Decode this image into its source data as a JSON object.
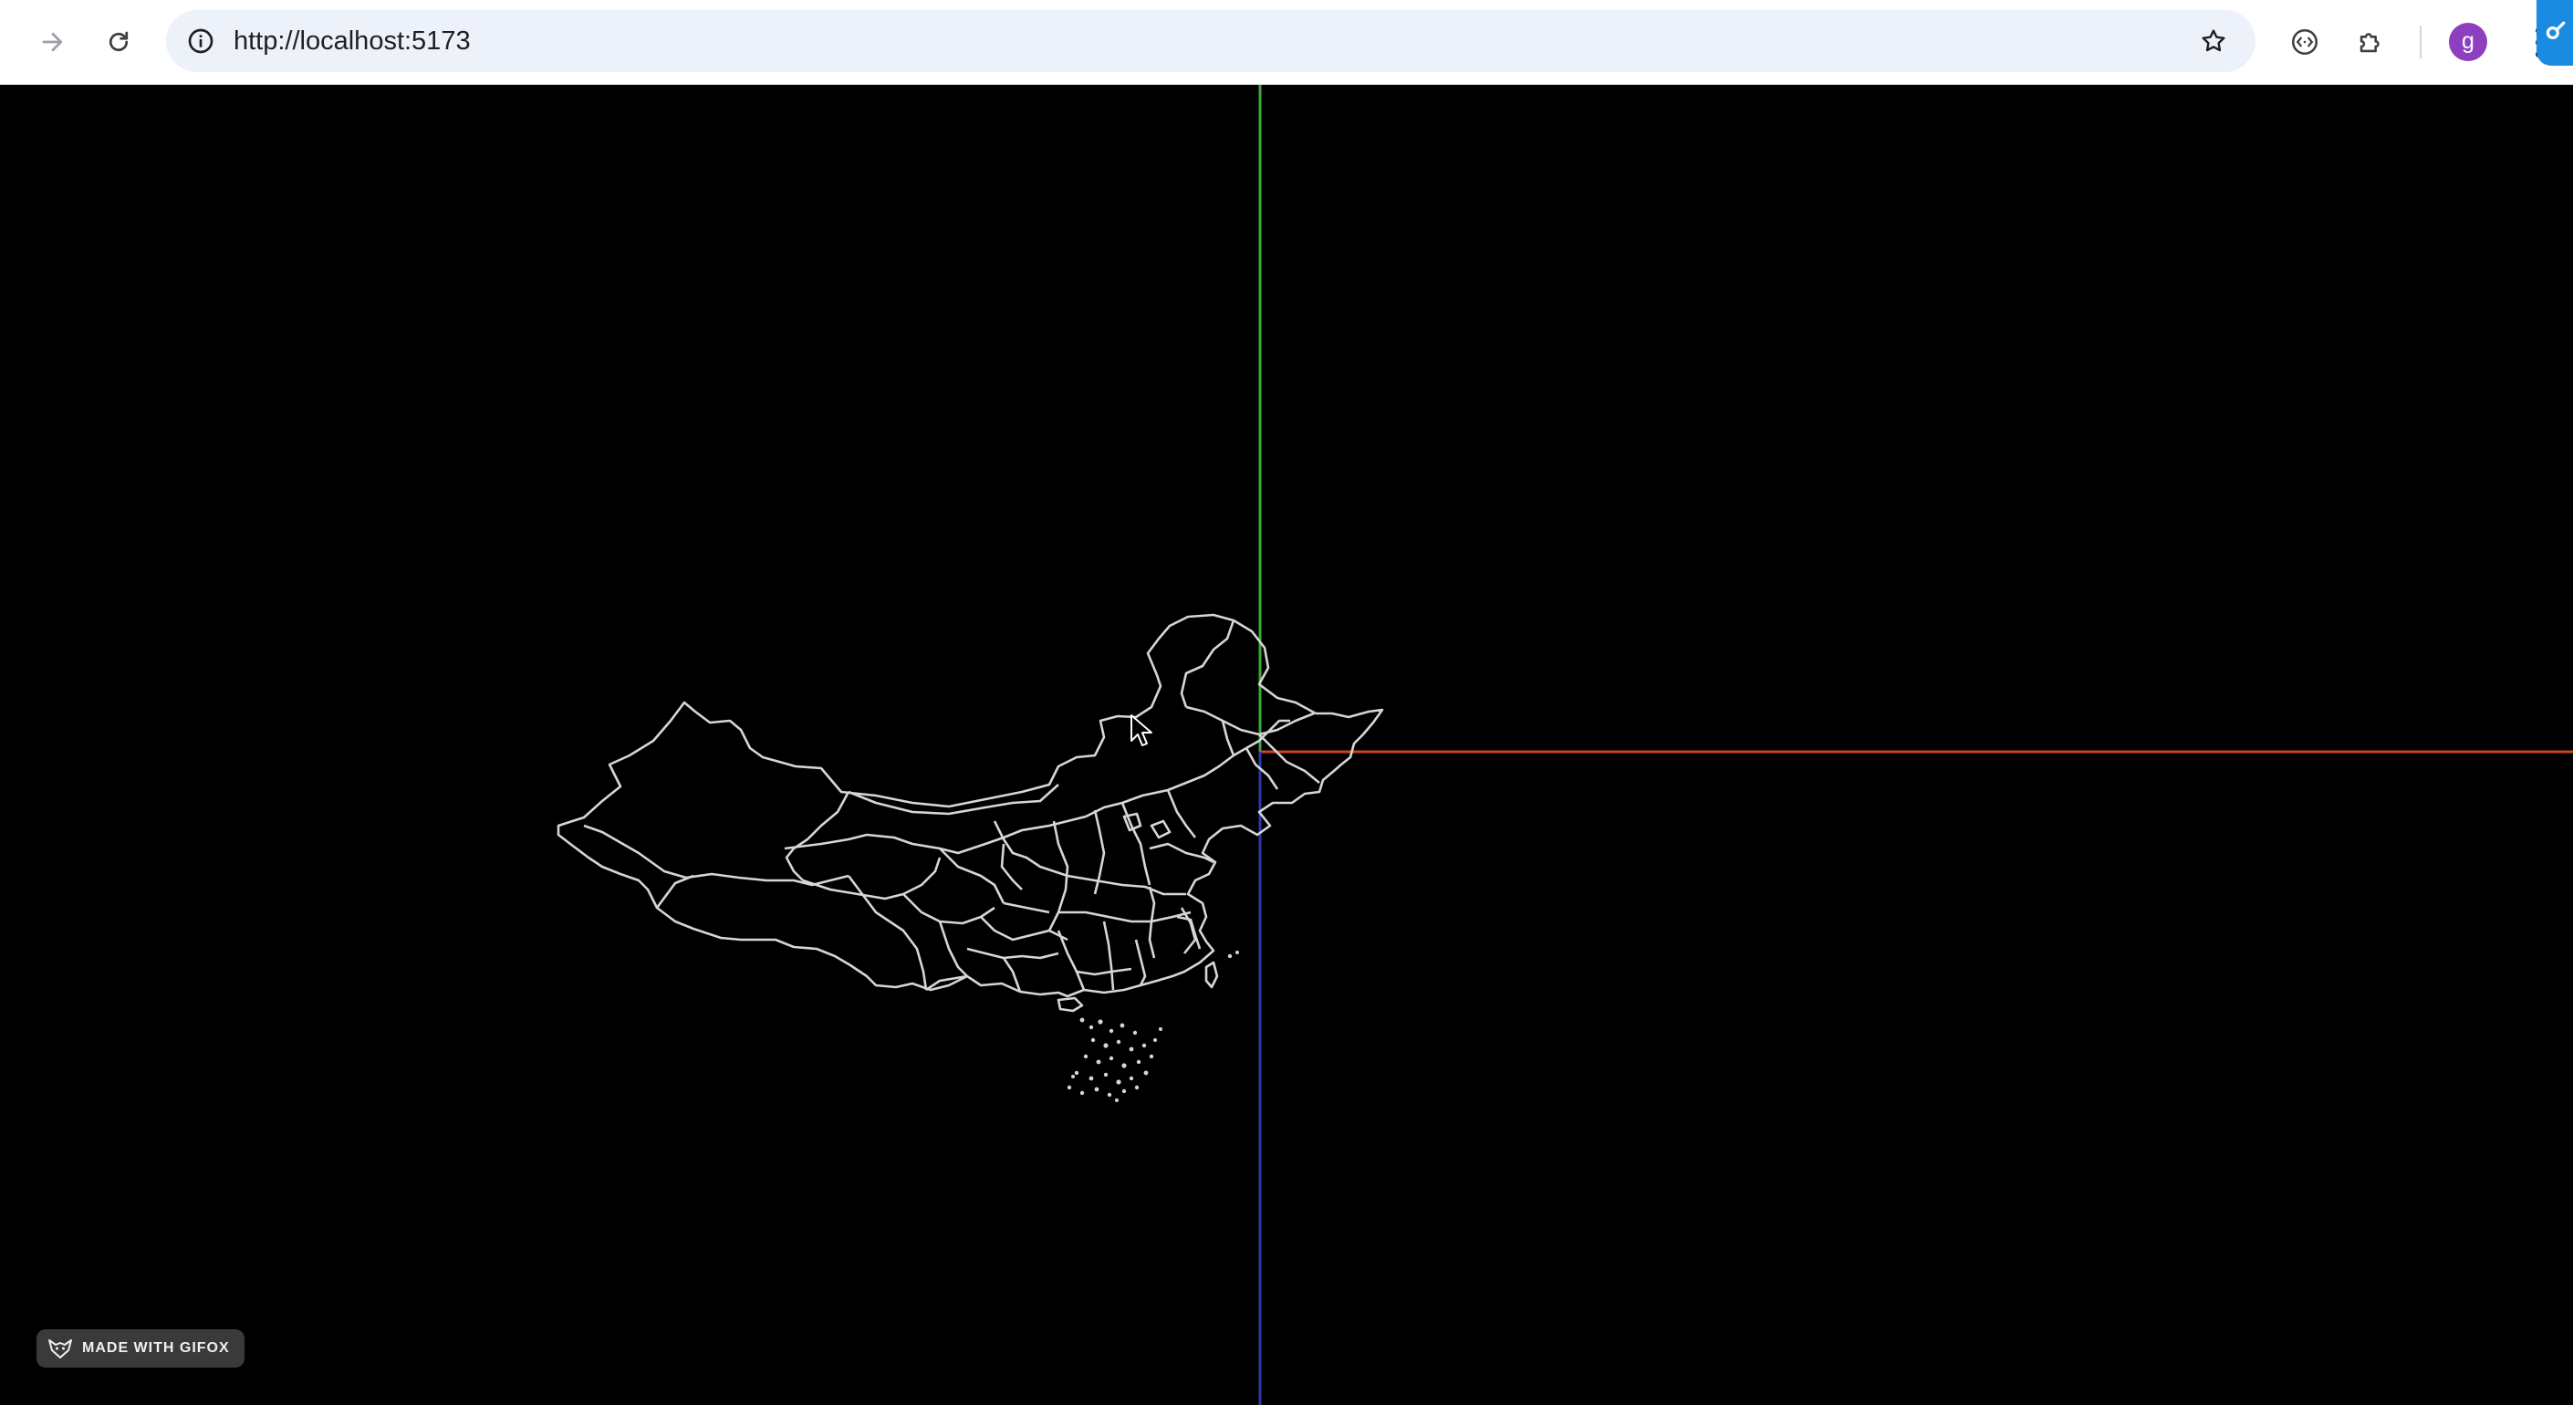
{
  "browser": {
    "url": "http://localhost:5173",
    "profile_initial": "g",
    "icons": [
      "forward-arrow-icon",
      "reload-icon",
      "site-info-icon",
      "bookmark-star-icon",
      "devtools-icon",
      "extensions-puzzle-icon",
      "kebab-menu-icon"
    ]
  },
  "scene": {
    "description_colors": {
      "background": "#000000",
      "map_outline": "#d6d6d6",
      "axis_x": "#c8461e",
      "axis_y": "#3fa83a",
      "axis_z": "#2a3aa8"
    }
  },
  "watermark": {
    "label": "MADE WITH GIFOX"
  }
}
